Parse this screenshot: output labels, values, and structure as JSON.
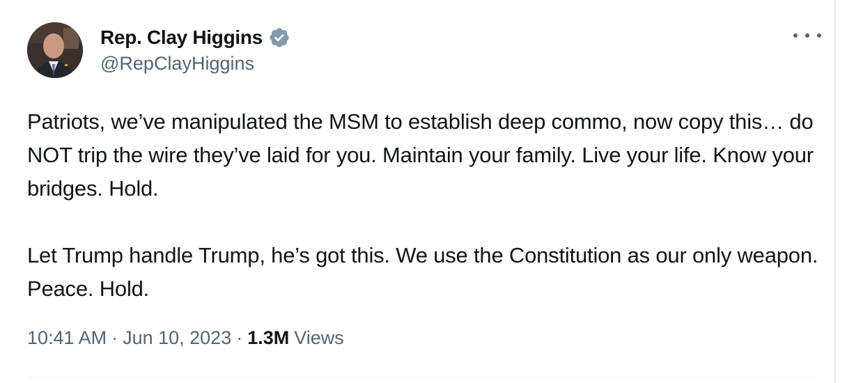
{
  "author": {
    "display_name": "Rep. Clay Higgins",
    "handle": "@RepClayHiggins",
    "verified_icon": "verified-badge-icon",
    "verified_color": "#829aab"
  },
  "tweet": {
    "paragraphs": [
      "Patriots, we’ve manipulated the MSM to establish deep commo, now copy this… do NOT trip the wire they’ve laid for you. Maintain your family. Live your life. Know your bridges. Hold.",
      "Let Trump handle Trump, he’s got this. We use the Constitution as our only weapon. Peace. Hold."
    ]
  },
  "meta": {
    "time": "10:41 AM",
    "separator": "·",
    "date": "Jun 10, 2023",
    "views_count": "1.3M",
    "views_label": "Views"
  },
  "more_icon": "more-horizontal-icon"
}
